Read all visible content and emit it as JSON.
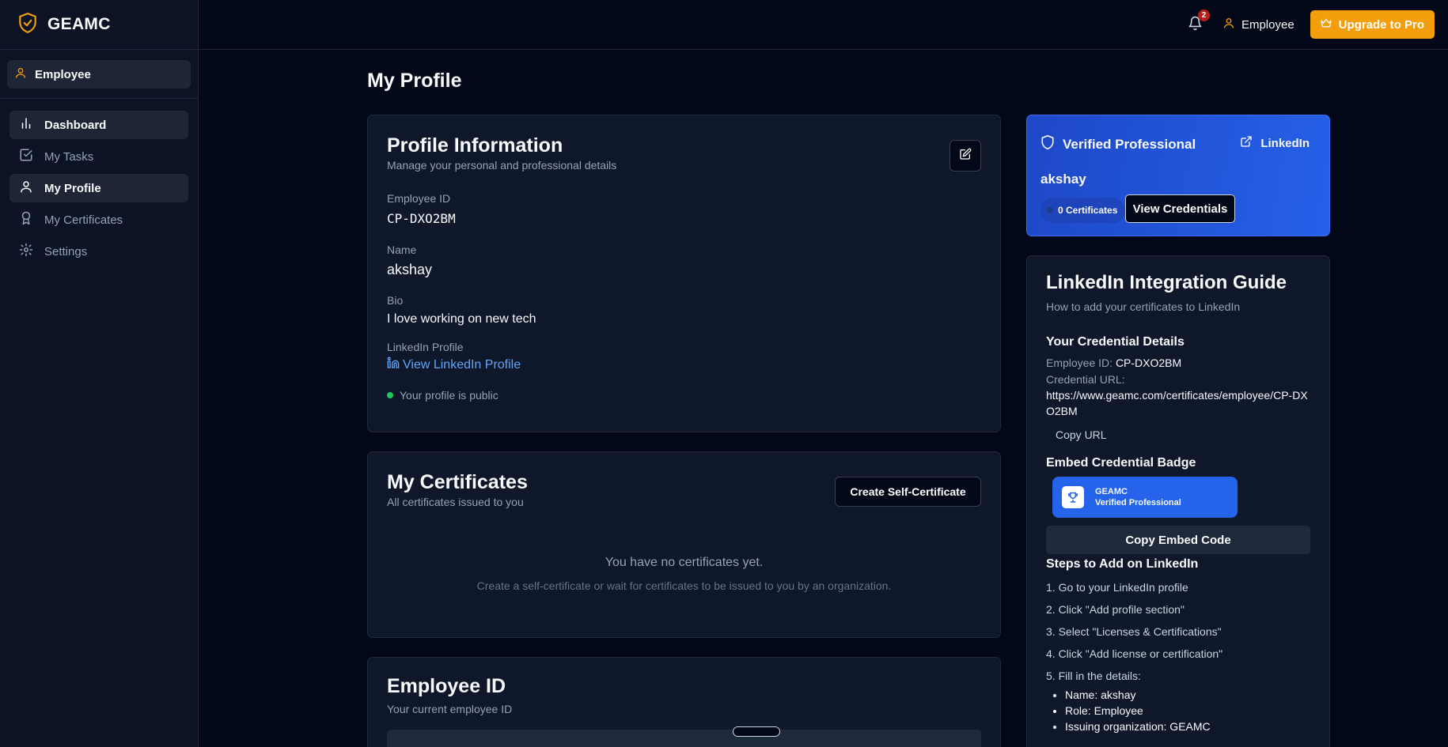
{
  "sidebar": {
    "brand": "GEAMC",
    "role": "Employee",
    "items": [
      {
        "label": "Dashboard",
        "icon": "bar-chart-icon"
      },
      {
        "label": "My Tasks",
        "icon": "checkbox-icon"
      },
      {
        "label": "My Profile",
        "icon": "user-icon"
      },
      {
        "label": "My Certificates",
        "icon": "award-icon"
      },
      {
        "label": "Settings",
        "icon": "gear-icon"
      }
    ]
  },
  "topbar": {
    "notification_count": "2",
    "user_label": "Employee",
    "upgrade_label": "Upgrade to Pro"
  },
  "page": {
    "title": "My Profile"
  },
  "profile": {
    "title": "Profile Information",
    "subtitle": "Manage your personal and professional details",
    "employee_id_label": "Employee ID",
    "employee_id": "CP-DXO2BM",
    "name_label": "Name",
    "name": "akshay",
    "bio_label": "Bio",
    "bio": "I love working on new tech",
    "linkedin_label": "LinkedIn Profile",
    "linkedin_link": "View LinkedIn Profile",
    "public_status": "Your profile is public"
  },
  "certificates": {
    "title": "My Certificates",
    "subtitle": "All certificates issued to you",
    "create_button": "Create Self-Certificate",
    "empty_title": "You have no certificates yet.",
    "empty_desc": "Create a self-certificate or wait for certificates to be issued to you by an organization."
  },
  "employee_id_card": {
    "title": "Employee ID",
    "subtitle": "Your current employee ID"
  },
  "verified": {
    "title": "Verified Professional",
    "linkedin": "LinkedIn",
    "name": "akshay",
    "certificates": "0 Certificates",
    "view_button": "View Credentials"
  },
  "guide": {
    "title": "LinkedIn Integration Guide",
    "subtitle": "How to add your certificates to LinkedIn",
    "cred_heading": "Your Credential Details",
    "emp_id_label": "Employee ID:",
    "emp_id": "CP-DXO2BM",
    "cred_url_label": "Credential URL:",
    "cred_url": "https://www.geamc.com/certificates/employee/CP-DXO2BM",
    "copy_url": "Copy URL",
    "embed_heading": "Embed Credential Badge",
    "badge_org": "GEAMC",
    "badge_text": "Verified Professional",
    "copy_embed": "Copy Embed Code",
    "steps_heading": "Steps to Add on LinkedIn",
    "steps": [
      "1. Go to your LinkedIn profile",
      "2. Click \"Add profile section\"",
      "3. Select \"Licenses & Certifications\"",
      "4. Click \"Add license or certification\"",
      "5. Fill in the details:"
    ],
    "details": [
      "Name: akshay",
      "Role: Employee",
      "Issuing organization: GEAMC"
    ]
  },
  "colors": {
    "background": "#020817",
    "accent": "#f59e0b",
    "link": "#60a5fa",
    "verified_blue": "#2563eb",
    "status_green": "#22c55e"
  }
}
